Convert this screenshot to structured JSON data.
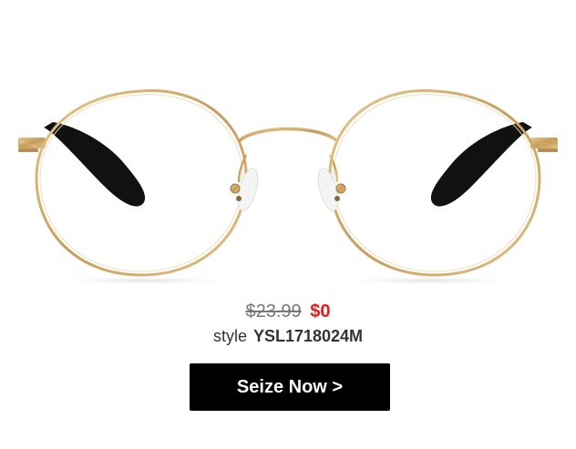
{
  "product": {
    "image_icon": "round-metal-eyeglasses",
    "frame_color": "#c9a46a",
    "temple_color": "#111111",
    "original_price": "$23.99",
    "sale_price": "$0",
    "style_label": "style",
    "style_code": "YSL1718024M"
  },
  "cta": {
    "label": "Seize Now >"
  },
  "colors": {
    "sale_price": "#e21b1b",
    "button_bg": "#000000",
    "button_text": "#ffffff"
  }
}
